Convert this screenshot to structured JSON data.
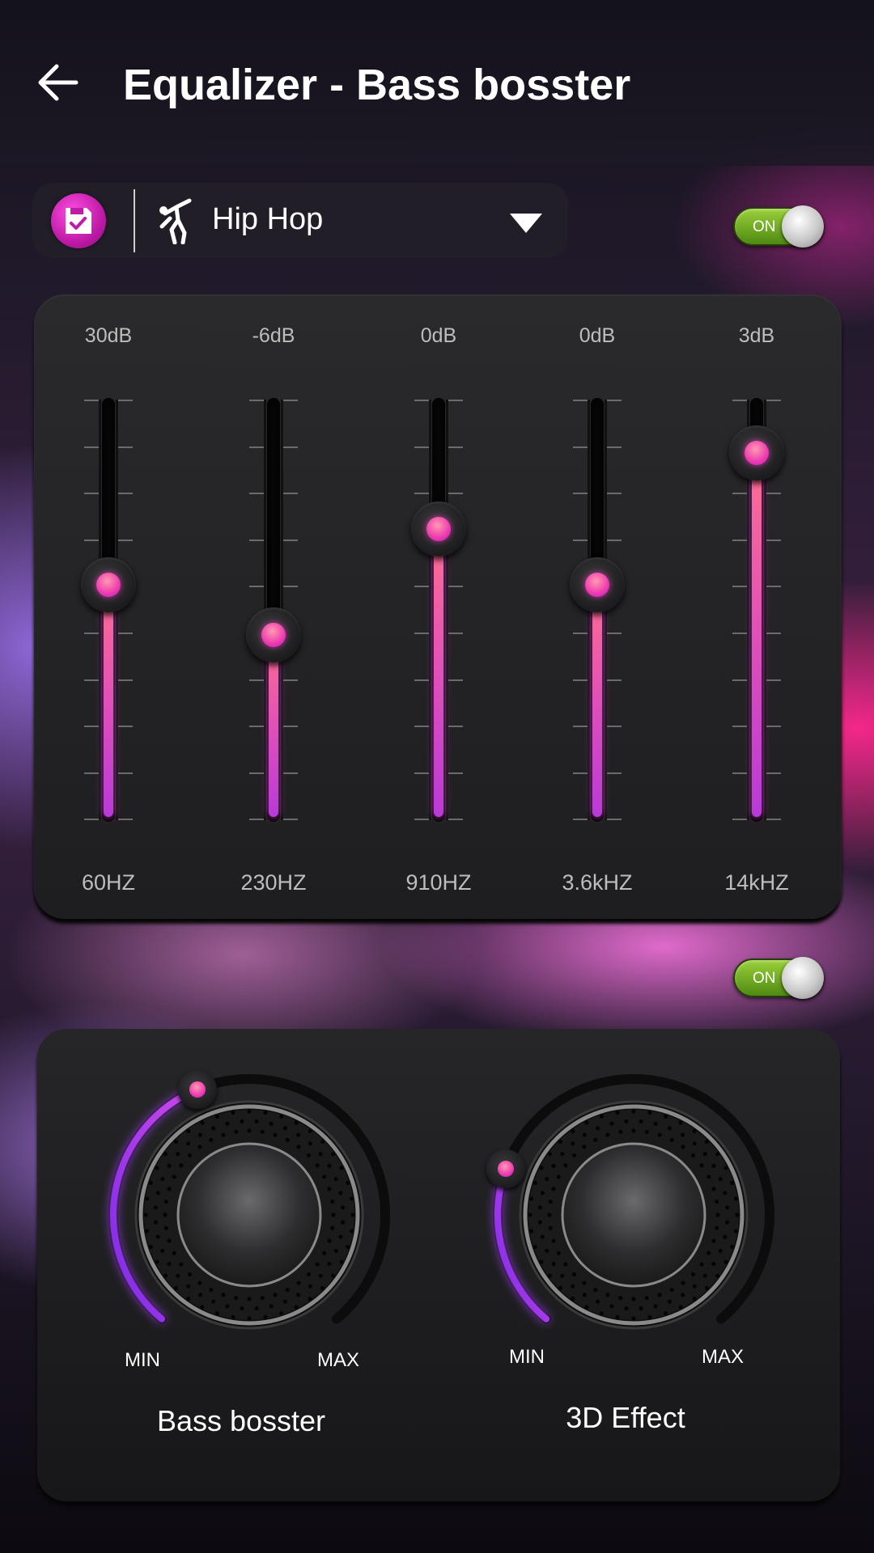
{
  "header": {
    "title": "Equalizer - Bass bosster",
    "back_icon": "arrow-left-icon"
  },
  "preset": {
    "save_icon": "save-check-icon",
    "genre_icon": "dancer-icon",
    "name": "Hip Hop",
    "dropdown_icon": "triangle-down-icon"
  },
  "equalizer": {
    "toggle_label": "ON",
    "enabled": true,
    "bands": [
      {
        "gain": "30dB",
        "freq": "60HZ",
        "level": 0.56
      },
      {
        "gain": "-6dB",
        "freq": "230HZ",
        "level": 0.44
      },
      {
        "gain": "0dB",
        "freq": "910HZ",
        "level": 0.69
      },
      {
        "gain": "0dB",
        "freq": "3.6kHZ",
        "level": 0.56
      },
      {
        "gain": "3dB",
        "freq": "14kHZ",
        "level": 0.87
      }
    ]
  },
  "effects": {
    "toggle_label": "ON",
    "enabled": true,
    "knobs": [
      {
        "title": "Bass bosster",
        "min_label": "MIN",
        "max_label": "MAX",
        "level": 0.42
      },
      {
        "title": "3D Effect",
        "min_label": "MIN",
        "max_label": "MAX",
        "level": 0.25
      }
    ]
  },
  "colors": {
    "accent_pink": "#ee3ab0",
    "accent_purple": "#9a3ae0",
    "toggle_green": "#7cb82a"
  }
}
